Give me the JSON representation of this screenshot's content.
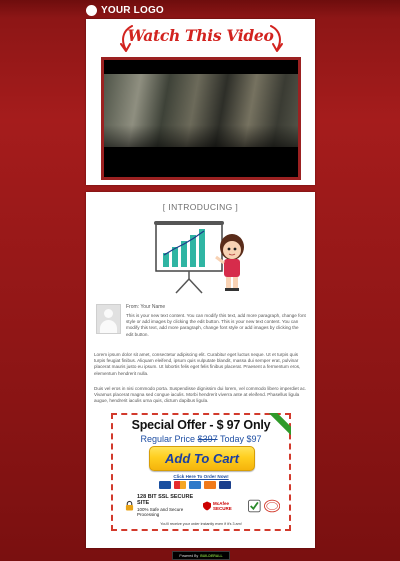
{
  "header": {
    "logo_text": "YOUR LOGO"
  },
  "video_panel": {
    "title": "Watch This Video",
    "icons": [
      "arrow-down-left-icon",
      "arrow-down-right-icon"
    ]
  },
  "content": {
    "section_label": "[ INTRODUCING ]",
    "from_label": "From: Your Name",
    "intro_paragraph": "This is your new text content. You can modify this text, add more paragraph, change font style or add images by clicking the edit button. This is your new text content. You can modify this text, add more paragraph, change font style or add images by clicking the edit button.",
    "lorem_paragraph_1": "Lorem ipsum dolor sit amet, consectetur adipiscing elit. Curabitur eget luctus neque. Ut et turpis quis turpis feugiat finibus. Aliquam eleifend, ipsum quis vulputate blandit, massa dui semper erat, pulvinar placerat mauris justo eu ipsum. Ut lobortis felis eget felis finibus placerat. Praesent a fermentum eros, elementum hendrerit nulla.",
    "lorem_paragraph_2": "Duis vel eros in nisi commodo porta. Suspendisse dignissim dui lorem, vel commodo libero imperdiet ac. Vivamus placerat magna sed congue iaculis. Morbi hendrerit viverra ante at eleifend. Phasellus ligula augue, hendrerit iaculis urna quis, dictum dapibus ligula."
  },
  "offer": {
    "title": "Special Offer - $ 97 Only",
    "regular_label": "Regular Price",
    "regular_price": "$397",
    "today_label": "Today $97",
    "cart_button": "Add To Cart",
    "order_link": "Click Here To Order Now!",
    "ssl_title": "128 BIT SSL SECURE SITE",
    "ssl_sub": "100% Safe and Secure Processing",
    "mcafee_label": "McAfee SECURE",
    "receive_note": "You'll receive your order instantly even if it's 3 am!",
    "colors": {
      "ribbon": "#2f9a2a",
      "border": "#d23a2c",
      "button": "#ffce1f"
    }
  },
  "footer": {
    "powered_by": "Powered By",
    "brand": "BUILDERALL"
  }
}
